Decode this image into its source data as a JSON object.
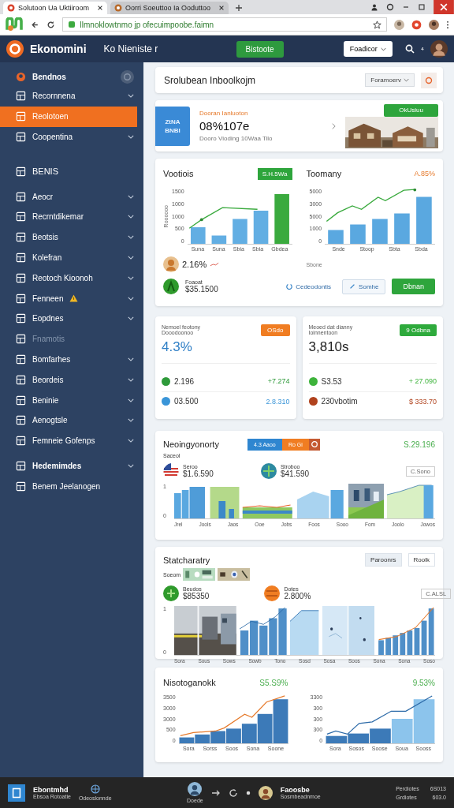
{
  "browser": {
    "tabs": [
      {
        "title": "Solutoon Ua Uktiiroom",
        "selected": true
      },
      {
        "title": "Oorri  Soeuttoo Ia Ooduttoo",
        "selected": false
      }
    ],
    "url": "Ilmnoklowtnmo jp ofecuimpoobe.faimn"
  },
  "header": {
    "brand": "Ekonomini",
    "subtitle": "Ko Nieniste r",
    "action": "Bistoote",
    "select": "Foadicor",
    "bell_count": "⁴"
  },
  "sidebar": {
    "items": [
      {
        "label": "Bendnos",
        "kind": "account",
        "selected": false,
        "disabled": false,
        "chevron": false
      },
      {
        "label": "Recornnena",
        "kind": "item",
        "selected": false,
        "disabled": false,
        "chevron": true
      },
      {
        "label": "Reolotoen",
        "kind": "item",
        "selected": true,
        "disabled": false,
        "chevron": false
      },
      {
        "label": "Coopentina",
        "kind": "item",
        "selected": false,
        "disabled": false,
        "chevron": true
      },
      {
        "label": "BENIS",
        "kind": "section",
        "selected": false,
        "disabled": false,
        "chevron": false
      },
      {
        "label": "Aeocr",
        "kind": "item",
        "selected": false,
        "disabled": false,
        "chevron": true
      },
      {
        "label": "Recrntdikemar",
        "kind": "item",
        "selected": false,
        "disabled": false,
        "chevron": true
      },
      {
        "label": "Beotsis",
        "kind": "item",
        "selected": false,
        "disabled": false,
        "chevron": true
      },
      {
        "label": "Kolefran",
        "kind": "item",
        "selected": false,
        "disabled": false,
        "chevron": true
      },
      {
        "label": "Reotoch Kioonoh",
        "kind": "item",
        "selected": false,
        "disabled": false,
        "chevron": true
      },
      {
        "label": "Fenneen",
        "kind": "warning",
        "selected": false,
        "disabled": false,
        "chevron": true
      },
      {
        "label": "Eopdnes",
        "kind": "item",
        "selected": false,
        "disabled": false,
        "chevron": true
      },
      {
        "label": "Fnamotis",
        "kind": "item",
        "selected": false,
        "disabled": true,
        "chevron": false
      },
      {
        "label": "Bomfarhes",
        "kind": "item",
        "selected": false,
        "disabled": false,
        "chevron": true
      },
      {
        "label": "Beordeis",
        "kind": "item",
        "selected": false,
        "disabled": false,
        "chevron": true
      },
      {
        "label": "Beninie",
        "kind": "item",
        "selected": false,
        "disabled": false,
        "chevron": true
      },
      {
        "label": "Aenogtsle",
        "kind": "item",
        "selected": false,
        "disabled": false,
        "chevron": true
      },
      {
        "label": "Femneie Gofenps",
        "kind": "item",
        "selected": false,
        "disabled": false,
        "chevron": true
      },
      {
        "label": "Hedemimdes",
        "kind": "group",
        "selected": false,
        "disabled": false,
        "chevron": true
      },
      {
        "label": "Benem Jeelanogen",
        "kind": "item",
        "selected": false,
        "disabled": false,
        "chevron": false
      }
    ]
  },
  "title_card": {
    "title": "Srolubean Inboolkojm",
    "select": "Foramoerv"
  },
  "promo": {
    "tile": [
      "ZtNA",
      "BNBI"
    ],
    "label": "Dooran Ianluoton",
    "value": "08%107e",
    "caption": "Dooro Vioding 10Waa Tilo",
    "button": "OkUsiuu"
  },
  "overview": {
    "left": {
      "title": "Vootiois",
      "badge": "S.H.5Wa",
      "y_labels": [
        "1500",
        "1000",
        "1000",
        "500",
        "0"
      ],
      "axis_title": "Roooooo",
      "x_labels": [
        "Suna",
        "Suna",
        "Sbia",
        "Sbia",
        "Gbdea"
      ],
      "value": "2.16%"
    },
    "right": {
      "title": "Toomany",
      "badge": "A.85%",
      "y_labels": [
        "5000",
        "3000",
        "5000",
        "1000",
        "0"
      ],
      "x_labels": [
        "Snde",
        "Stoop",
        "Sbta",
        "Sbda"
      ],
      "note": "Sbone"
    },
    "footer": {
      "label": "Foaoat",
      "amount": "$35.1500",
      "link": "Cedeodontis",
      "outline_button": "Somhe",
      "button": "Dbnan"
    }
  },
  "kpis": [
    {
      "title": "Nemoel feotony",
      "subtitle": "Dooodoonoo",
      "badge": "OSdo",
      "color": "#f07d22",
      "value": "4.3%",
      "rows": [
        {
          "label": "2.196",
          "change": "+7.274",
          "color": "#2e9a3a"
        },
        {
          "label": "03.500",
          "change": "2.8.310",
          "color": "#3a95d8"
        }
      ]
    },
    {
      "title": "Meoed dat dianny",
      "subtitle": "Ioinnentoon",
      "badge": "9 Odbna",
      "color": "#2eaa3c",
      "value": "3,810s",
      "rows": [
        {
          "label": "S3.53",
          "change": "+ 27.090",
          "color": "#3db33b"
        },
        {
          "label": "230vbotim",
          "change": "$ 333.70",
          "color": "#b0421d"
        }
      ]
    }
  ],
  "economy": {
    "title": "Neoingyonorty",
    "segments": [
      "4.3 Aaoo",
      "Ro Gi"
    ],
    "total": "S.29.196",
    "label": "Saceol",
    "entries": [
      {
        "name": "Seroo",
        "amount": "$1.6.590"
      },
      {
        "name": "Stroboo",
        "amount": "$41.590"
      }
    ],
    "tag": "C.Sono",
    "y_labels": [
      "1",
      "0"
    ],
    "x_labels": [
      "Jrel",
      "Jools",
      "Jaos",
      "Ooe",
      "Jobs",
      "Foos",
      "Sooo",
      "Fom",
      "Joolo",
      "Jowos"
    ]
  },
  "stats": {
    "title": "Statcharatry",
    "buttons": [
      "Paroonrs",
      "Roolk"
    ],
    "label": "Soeom",
    "entries": [
      {
        "name": "Beudos",
        "amount": "$85350"
      },
      {
        "name": "Dotes",
        "amount": "2.800%"
      }
    ],
    "tag": "C.ALSL",
    "y_labels": [
      "1",
      "0"
    ],
    "x_labels": [
      "Sora",
      "Sous",
      "Sows",
      "Sowb",
      "Tono",
      "Sosd",
      "Sosa",
      "Soos",
      "Sona",
      "Sona",
      "Soso"
    ]
  },
  "growth": {
    "title": "Nisotoganokk",
    "left_value": "S5.S9%",
    "right_value": "9.53%",
    "left": {
      "y_labels": [
        "3500",
        "3000",
        "3000",
        "500",
        "0"
      ],
      "x_labels": [
        "Sora",
        "Sorss",
        "Soos",
        "Sona",
        "Soone"
      ]
    },
    "right": {
      "y_labels": [
        "3300",
        "300",
        "300",
        "300",
        "0"
      ],
      "x_labels": [
        "Sora",
        "Sosos",
        "Soose",
        "Soua",
        "Sooss"
      ]
    }
  },
  "taskbar": {
    "app": "Ebontmhd",
    "app_sub": "Ebsoa Rotoatie",
    "globe_label": "Odeoslonnde",
    "user1": "Doede",
    "user2": "Faoosbe",
    "user2_sub": "Sosmbeadnmoe",
    "stats": [
      {
        "label": "Perdiotes",
        "value": "6S013"
      },
      {
        "label": "Grdiotes",
        "value": "603.0"
      }
    ]
  }
}
